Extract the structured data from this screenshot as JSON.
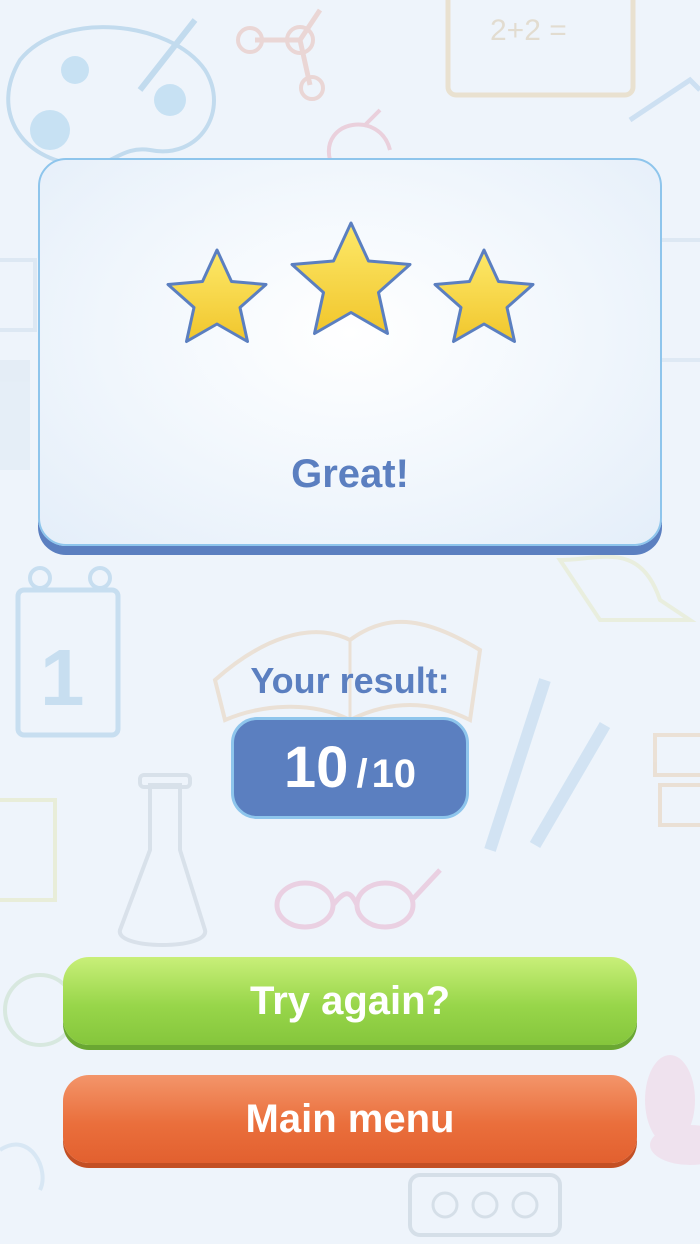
{
  "result_card": {
    "stars_earned": 3,
    "stars_total": 3,
    "message": "Great!"
  },
  "result": {
    "label": "Your result:",
    "score": "10",
    "separator": "/",
    "total": "10"
  },
  "buttons": {
    "try_again": "Try again?",
    "main_menu": "Main menu"
  },
  "background": {
    "doodle_text": "2+2 =",
    "calendar_number": "1"
  },
  "colors": {
    "accent_blue": "#5b7fc0",
    "card_border": "#8ec5ec",
    "star_fill": "#f7d93f",
    "try_again_green": "#98d64a",
    "main_menu_orange": "#ea6f3c"
  }
}
